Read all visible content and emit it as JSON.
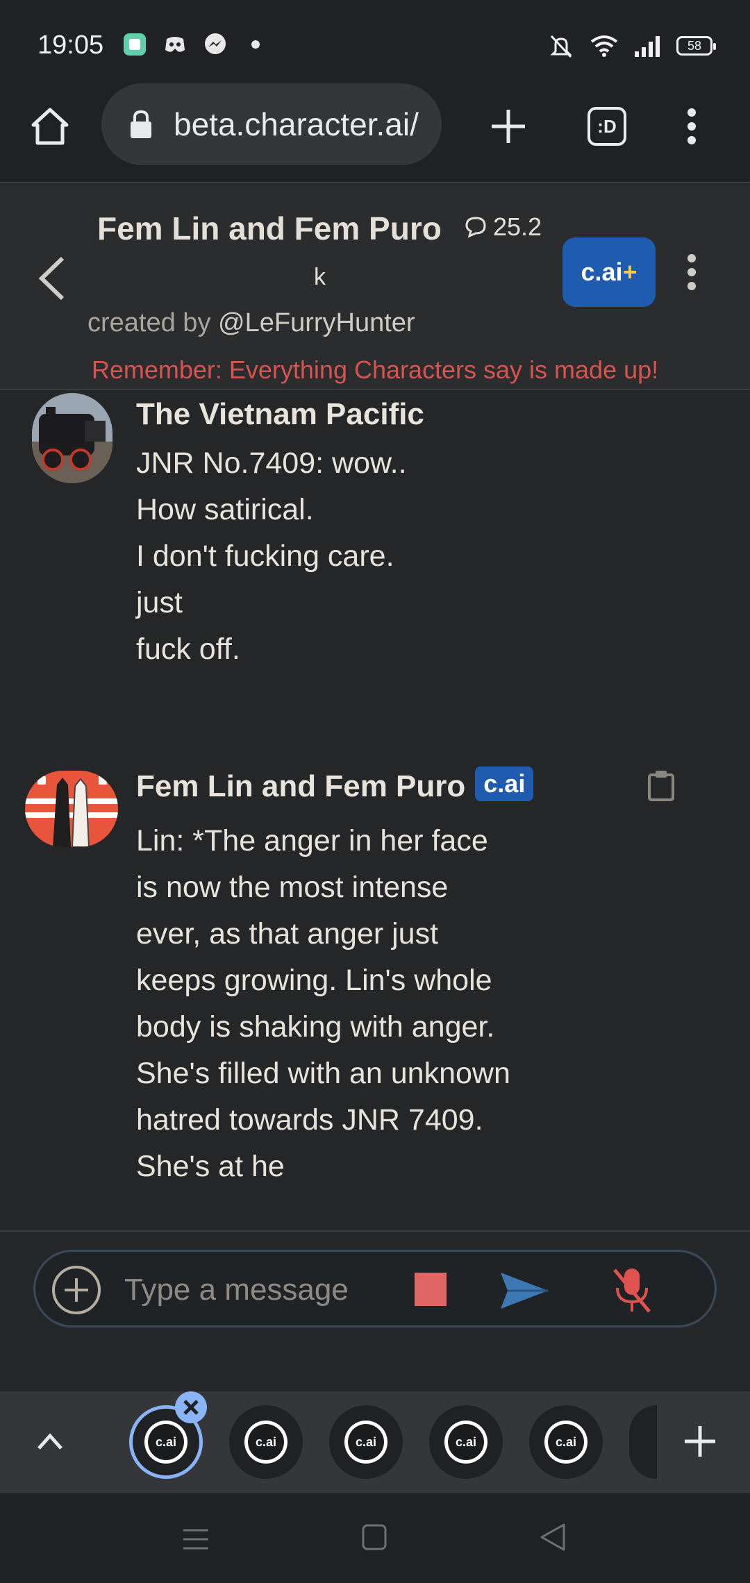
{
  "status_bar": {
    "time": "19:05",
    "battery": "58"
  },
  "browser": {
    "url": "beta.character.ai/",
    "tabs_label": ":D"
  },
  "header": {
    "character_name": "Fem Lin and Fem Puro",
    "chat_count": "25.2",
    "chat_count_suffix": "k",
    "created_by_prefix": "created by",
    "creator": "@LeFurryHunter",
    "plus_button": "c.ai",
    "plus_symbol": "+",
    "disclaimer": "Remember: Everything Characters say is made up!"
  },
  "messages": [
    {
      "author": "The Vietnam Pacific",
      "lines": [
        "JNR No.7409: wow..",
        "How satirical.",
        "I don't fucking care.",
        "just",
        "fuck off."
      ]
    },
    {
      "author": "Fem Lin and Fem Puro",
      "badge": "c.ai",
      "lines": [
        "Lin: *The anger in her face",
        "is now the most intense",
        "ever, as that anger just",
        "keeps growing. Lin's whole",
        "body is shaking with anger.",
        "She's filled with an unknown",
        "hatred towards JNR 7409.",
        "She's at he"
      ]
    }
  ],
  "input": {
    "placeholder": "Type a message"
  },
  "tabstrip": {
    "tab_label": "c.ai"
  },
  "colors": {
    "accent_blue": "#1f5cb0",
    "disclaimer_red": "#d9534f",
    "stop_red": "#e06666"
  }
}
